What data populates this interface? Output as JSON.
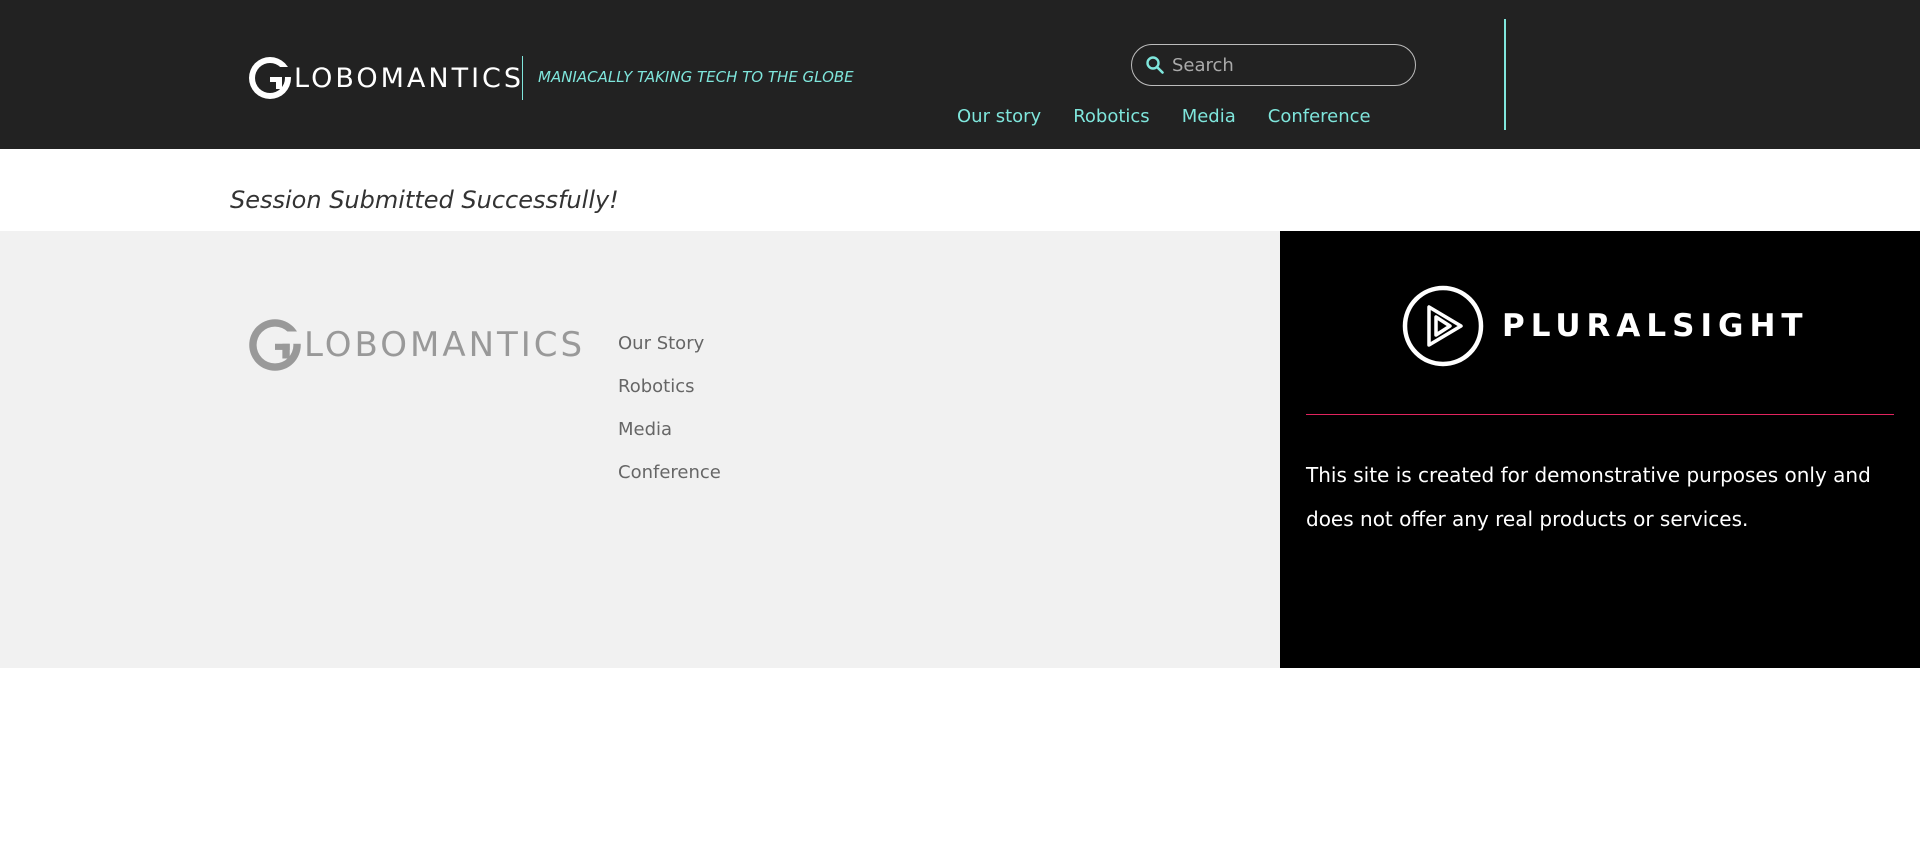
{
  "header": {
    "brand_name": "LOBOMANTICS",
    "tagline": "MANIACALLY TAKING TECH TO THE GLOBE",
    "search": {
      "placeholder": "Search",
      "value": ""
    },
    "nav": [
      "Our story",
      "Robotics",
      "Media",
      "Conference"
    ]
  },
  "status": {
    "message": "Session Submitted Successfully!"
  },
  "footer": {
    "brand_name": "LOBOMANTICS",
    "links": [
      "Our Story",
      "Robotics",
      "Media",
      "Conference"
    ]
  },
  "pluralsight": {
    "brand_name": "PLURALSIGHT",
    "disclaimer": "This site is created for demonstrative purposes only and does not offer any real products or services."
  },
  "colors": {
    "header_bg": "#222222",
    "accent": "#7fe6dc",
    "footer_bg": "#f1f1f1",
    "pluralsight_bg": "#000000",
    "pluralsight_rule": "#e0245e"
  },
  "icons": {
    "brand": "globomantics-g-logo-icon",
    "search": "search-icon",
    "pluralsight": "pluralsight-play-icon"
  }
}
